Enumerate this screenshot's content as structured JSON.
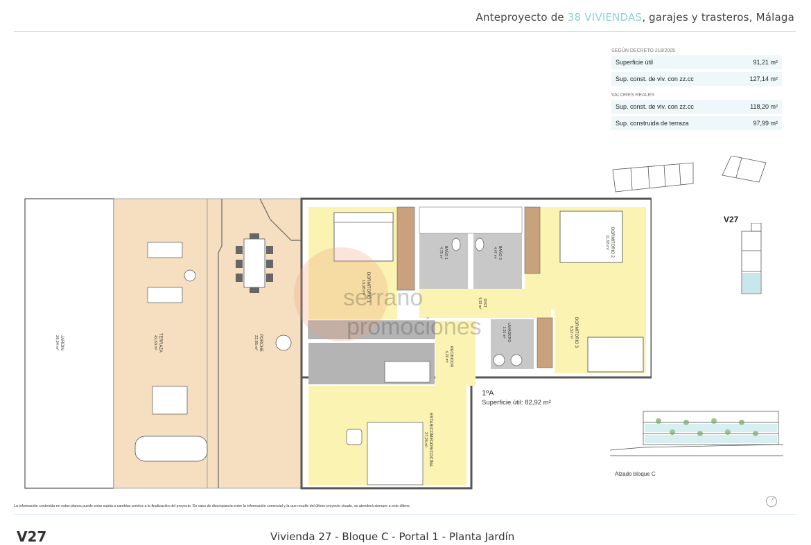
{
  "header": {
    "prefix": "Anteproyecto de ",
    "accent": "38 VIVIENDAS",
    "suffix": ", garajes y trasteros, Málaga"
  },
  "areas": {
    "decree_caption": "SEGÚN DECRETO 218/2005",
    "decree_rows": [
      {
        "label": "Superficie útil",
        "value": "91,21 m²"
      },
      {
        "label": "Sup. const. de viv. con zz.cc",
        "value": "127,14 m²"
      }
    ],
    "real_caption": "VALORES REALES",
    "real_rows": [
      {
        "label": "Sup. const. de viv. con zz.cc",
        "value": "118,20 m²"
      },
      {
        "label": "Sup. construida de terraza",
        "value": "97,99 m²"
      }
    ]
  },
  "plan": {
    "rooms": [
      {
        "name": "JARDIN",
        "area": "26,54 m²"
      },
      {
        "name": "TERRAZA",
        "area": "42,63 m²"
      },
      {
        "name": "PORCHE",
        "area": "22,85 m²"
      },
      {
        "name": "DORMITORIO 1",
        "area": "15,28 m²"
      },
      {
        "name": "BAÑO 1",
        "area": "4,75 m²"
      },
      {
        "name": "BAÑO 2",
        "area": "4,47 m²"
      },
      {
        "name": "DORMITORIO 2",
        "area": "11,93 m²"
      },
      {
        "name": "DIST.",
        "area": "5,53 m²"
      },
      {
        "name": "LAVADERO",
        "area": "2,31 m²"
      },
      {
        "name": "DORMITORIO 3",
        "area": "9,52 m²"
      },
      {
        "name": "RECIBIDOR",
        "area": "4,29 m²"
      },
      {
        "name": "ESTAR/COMEDOR/COCINA",
        "area": "27,26 m²"
      }
    ],
    "unit_code": "1ºA",
    "unit_area": "Superficie útil: 82,92 m²",
    "watermark_line1": "serrano",
    "watermark_line2": "promociones"
  },
  "side": {
    "unit_label": "V27",
    "elevation_label": "Alzado bloque C"
  },
  "disclaimer": "La información contenida en estos planos puede estar sujeta a cambios previos a la finalización del proyecto. En caso de discrepancia entre la información comercial y la que resulte del último proyecto visado, se atenderá siempre a este último.",
  "footer": {
    "code": "V27",
    "title": "Vivienda 27 - Bloque C - Portal 1 - Planta Jardín"
  },
  "colors": {
    "accent": "#8fd0d6",
    "room_fill": "#fbf3b2",
    "terrace_fill": "#f6dfc0",
    "bath_fill": "#c8c8c8",
    "kitchen_fill": "#b4b4b4"
  }
}
